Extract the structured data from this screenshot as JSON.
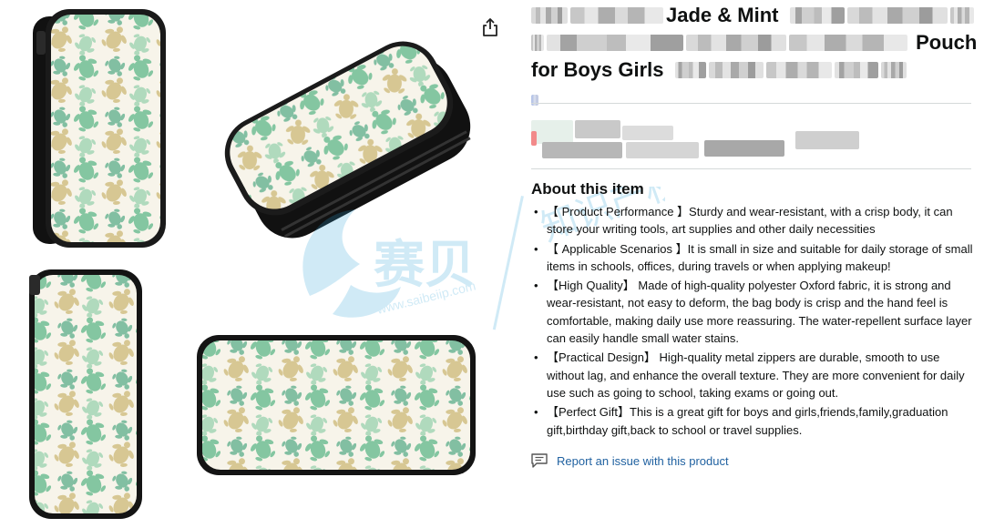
{
  "title": {
    "line1_visible": "Jade & Mint",
    "line2_visible": "Pouch",
    "line3_visible": "for Boys Girls"
  },
  "about": {
    "heading": "About this item",
    "bullets": [
      "【 Product Performance 】Sturdy and wear-resistant, with a crisp body, it can store your writing tools, art supplies and other daily necessities",
      "【 Applicable Scenarios 】It is small in size and suitable for daily storage of small items in schools, offices, during travels or when applying makeup!",
      "【High Quality】 Made of high-quality polyester Oxford fabric, it is strong and wear-resistant, not easy to deform, the bag body is crisp and the hand feel is comfortable, making daily use more reassuring. The water-repellent surface layer can easily handle small water stains.",
      "【Practical Design】 High-quality metal zippers are durable, smooth to use without lag, and enhance the overall texture. They are more convenient for daily use such as going to school, taking exams or going out.",
      "【Perfect Gift】This is a great gift for boys and girls,friends,family,graduation gift,birthday gift,back to school or travel supplies."
    ]
  },
  "report": {
    "label": "Report an issue with this product"
  },
  "watermark": {
    "brand": "赛贝",
    "url": "www.saibeiip.com",
    "tagline": "知识产权"
  },
  "icons": {
    "share": "share-icon",
    "report": "report-icon"
  },
  "colors": {
    "link": "#2162a1",
    "divider": "#d5d9d9",
    "turtle_green": "#5fb38a",
    "turtle_gold": "#c9b87a",
    "pouch_bg": "#f7f4ea",
    "pouch_border": "#111111"
  }
}
